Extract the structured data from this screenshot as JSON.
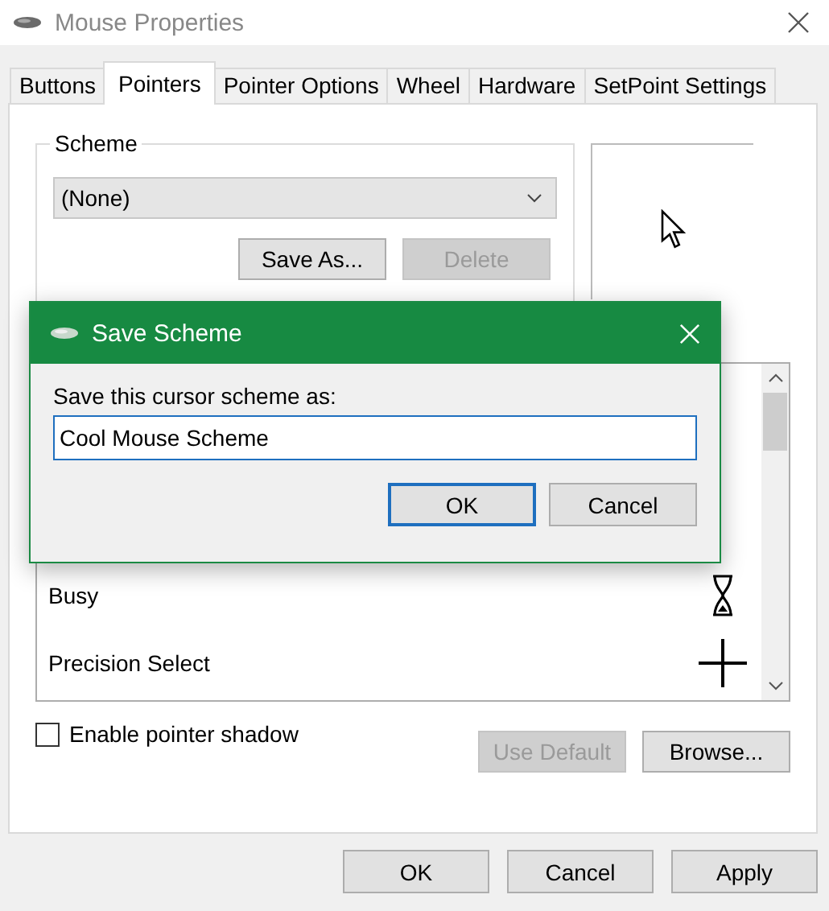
{
  "window": {
    "title": "Mouse Properties"
  },
  "tabs": [
    {
      "label": "Buttons",
      "selected": false
    },
    {
      "label": "Pointers",
      "selected": true
    },
    {
      "label": "Pointer Options",
      "selected": false
    },
    {
      "label": "Wheel",
      "selected": false
    },
    {
      "label": "Hardware",
      "selected": false
    },
    {
      "label": "SetPoint Settings",
      "selected": false
    }
  ],
  "scheme": {
    "label": "Scheme",
    "dropdown_value": "(None)",
    "buttons": [
      {
        "label": "Save As...",
        "disabled": false
      },
      {
        "label": "Delete",
        "disabled": true
      }
    ]
  },
  "cursor_list": {
    "rows": [
      {
        "name": "Busy",
        "kind": "hourglass"
      },
      {
        "name": "Precision Select",
        "kind": "crosshair"
      }
    ]
  },
  "pointer_shadow": {
    "label": "Enable pointer shadow",
    "checked": false
  },
  "list_buttons": [
    {
      "label": "Use Default",
      "disabled": true
    },
    {
      "label": "Browse...",
      "disabled": false
    }
  ],
  "footer_buttons": [
    "OK",
    "Cancel",
    "Apply"
  ],
  "dialog": {
    "title": "Save Scheme",
    "prompt": "Save this cursor scheme as:",
    "value": "Cool Mouse Scheme",
    "buttons": [
      {
        "label": "OK",
        "default": true
      },
      {
        "label": "Cancel",
        "default": false
      }
    ]
  }
}
